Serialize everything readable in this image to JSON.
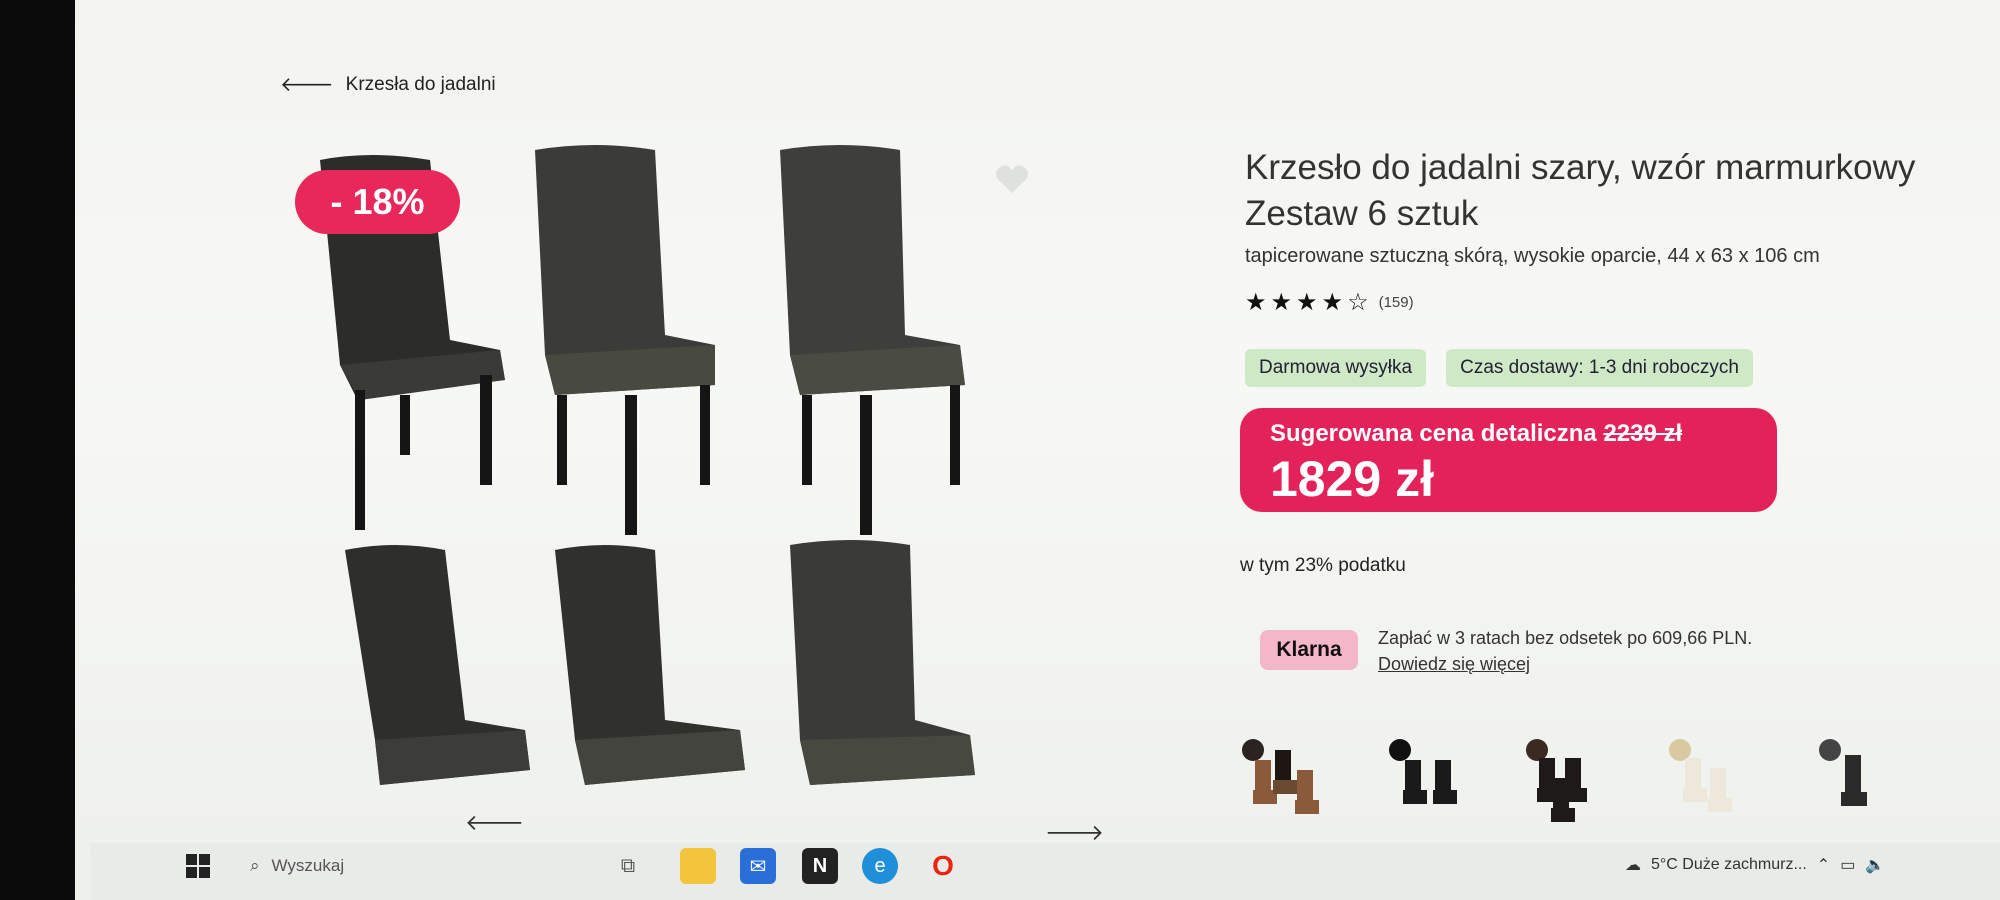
{
  "breadcrumb": {
    "back_label": "Krzesła do jadalni"
  },
  "gallery": {
    "discount_badge": "- 18%"
  },
  "product": {
    "title_line1": "Krzesło do jadalni szary, wzór marmurkowy",
    "title_line2": "Zestaw 6 sztuk",
    "subtitle": "tapicerowane sztuczną skórą, wysokie oparcie, 44 x 63 x 106 cm",
    "rating_stars": 4,
    "rating_max": 5,
    "rating_count": "(159)"
  },
  "badges": {
    "shipping": "Darmowa wysyłka",
    "delivery": "Czas dostawy: 1-3 dni roboczych"
  },
  "price": {
    "label": "Sugerowana cena detaliczna",
    "old": "2239 zł",
    "current": "1829 zł",
    "tax_note": "w tym 23% podatku",
    "box_color": "#e3225a"
  },
  "klarna": {
    "logo": "Klarna",
    "text": "Zapłać w 3 ratach bez odsetek po 609,66 PLN.",
    "link": "Dowiedz się więcej"
  },
  "variants": [
    {
      "name": "brown-leather-set",
      "swatch": "#2a2320",
      "chair": "#8a5a3a"
    },
    {
      "name": "black-set",
      "swatch": "#111111",
      "chair": "#1a1a1a"
    },
    {
      "name": "dark-brown-set",
      "swatch": "#3a2a22",
      "chair": "#1e1a18"
    },
    {
      "name": "cream-set",
      "swatch": "#d9c9a0",
      "chair": "#ede8da"
    },
    {
      "name": "grey-set",
      "swatch": "#444444",
      "chair": "#2a2a2a"
    }
  ],
  "taskbar": {
    "search_placeholder": "Wyszukaj",
    "weather": "5°C  Duże zachmurz..."
  }
}
